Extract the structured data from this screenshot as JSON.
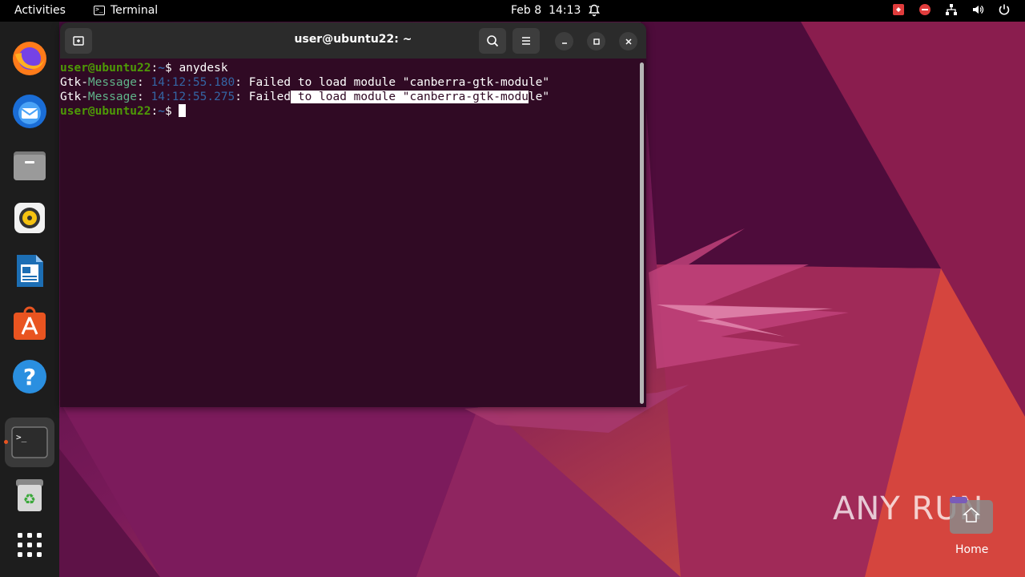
{
  "topbar": {
    "activities": "Activities",
    "app_name": "Terminal",
    "date": "Feb 8",
    "time": "14:13"
  },
  "dock": {
    "items": [
      "firefox-icon",
      "thunderbird-icon",
      "files-icon",
      "rhythmbox-icon",
      "libreoffice-writer-icon",
      "app-center-icon",
      "help-icon",
      "terminal-icon",
      "trash-icon",
      "show-apps-icon"
    ]
  },
  "terminal": {
    "title": "user@ubuntu22: ~",
    "lines": [
      {
        "user": "user@ubuntu22",
        "sep": ":",
        "path": "~",
        "prompt": "$ ",
        "cmd": "anydesk"
      },
      {
        "prefix": "Gtk-",
        "msg": "Message",
        "colon": ": ",
        "time": "14:12:55.180",
        "text": ": Failed to load module \"canberra-gtk-module\""
      },
      {
        "prefix": "Gtk-",
        "msg": "Message",
        "colon": ": ",
        "time": "14:12:55.275",
        "text_before": ": Failed",
        "text_selected": " to load module \"canberra-gtk-modu",
        "text_after": "le\""
      },
      {
        "user": "user@ubuntu22",
        "sep": ":",
        "path": "~",
        "prompt": "$ ",
        "cmd": ""
      }
    ]
  },
  "desktop": {
    "home_label": "Home",
    "watermark": "ANY RUN"
  },
  "colors": {
    "terminal_bg": "#300a24",
    "accent": "#e95420"
  }
}
